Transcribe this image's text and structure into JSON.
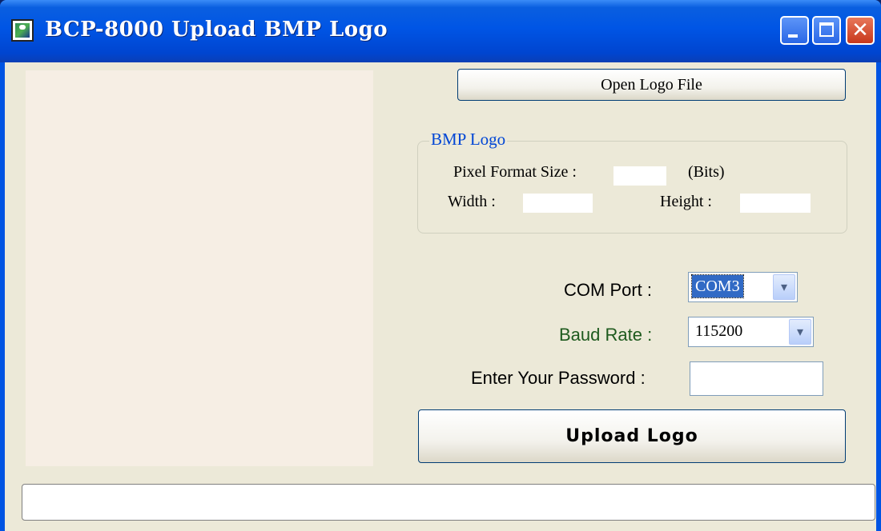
{
  "window": {
    "title": "BCP-8000 Upload BMP Logo"
  },
  "buttons": {
    "open_logo": "Open Logo File",
    "upload_logo": "Upload Logo"
  },
  "bmp_logo": {
    "legend": "BMP Logo",
    "pixel_format_label": "Pixel Format Size :",
    "pixel_format_value": "",
    "bits_unit": "(Bits)",
    "width_label": "Width :",
    "width_value": "",
    "height_label": "Height :",
    "height_value": ""
  },
  "connection": {
    "com_port_label": "COM Port :",
    "com_port_value": "COM3",
    "baud_rate_label": "Baud Rate :",
    "baud_rate_value": "115200",
    "password_label": "Enter Your Password :",
    "password_value": ""
  },
  "status_bar": {
    "text": ""
  },
  "colors": {
    "baud_label": "#1e5a1e",
    "legend": "#0046d5",
    "selection": "#316ac5"
  }
}
